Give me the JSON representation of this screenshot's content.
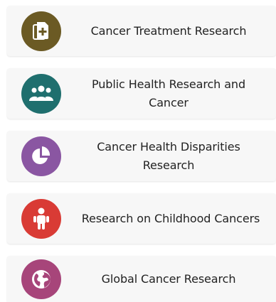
{
  "items": [
    {
      "label": "Cancer Treatment Research",
      "icon": "treatment-document-plus-icon",
      "color": "#6b5a24"
    },
    {
      "label": "Public Health Research and Cancer",
      "icon": "people-group-icon",
      "color": "#1f6f6e"
    },
    {
      "label": "Cancer Health Disparities Research",
      "icon": "pie-chart-icon",
      "color": "#8a56a2"
    },
    {
      "label": "Research on Childhood Cancers",
      "icon": "child-icon",
      "color": "#d93b35"
    },
    {
      "label": "Global Cancer Research",
      "icon": "globe-icon",
      "color": "#a7457a"
    }
  ]
}
